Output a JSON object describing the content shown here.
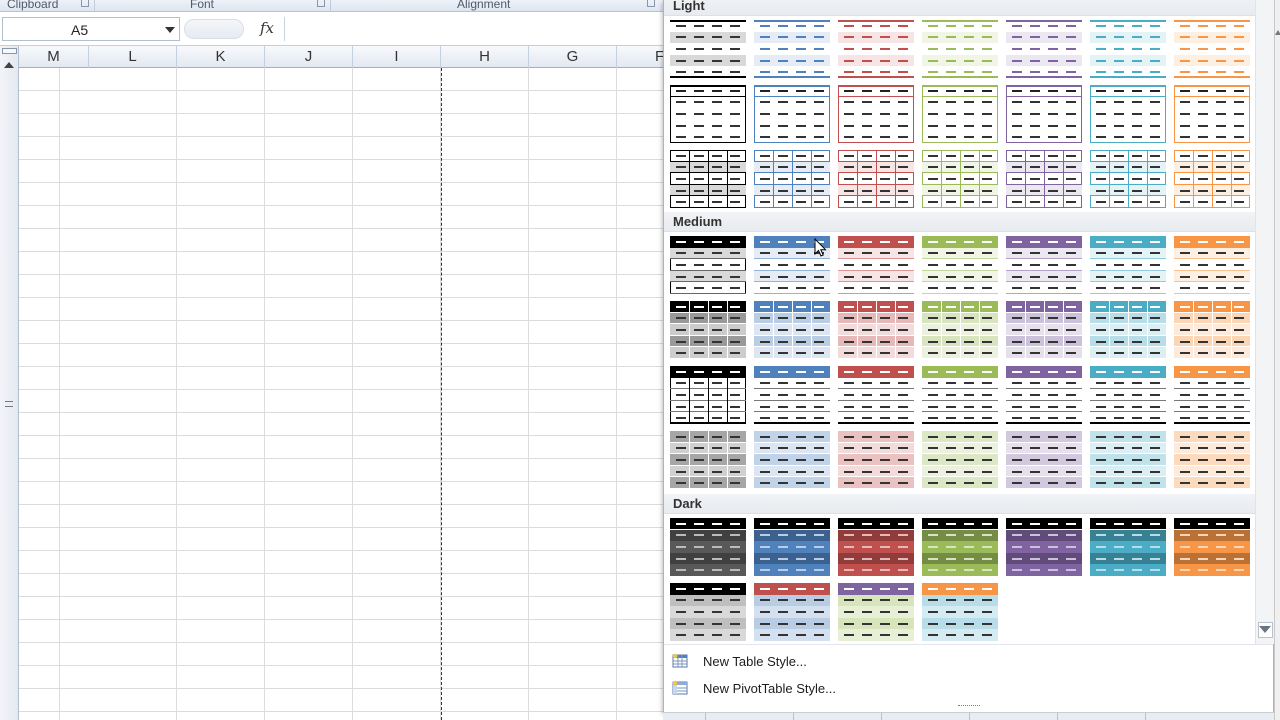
{
  "ribbon_groups": [
    {
      "label": "Clipboard",
      "has_launcher": true
    },
    {
      "label": "Font",
      "has_launcher": true
    },
    {
      "label": "Alignment",
      "has_launcher": true
    }
  ],
  "formula_bar": {
    "name_box_value": "A5",
    "fx_icon": "fx",
    "formula_value": ""
  },
  "sheet": {
    "columns": [
      "M",
      "L",
      "K",
      "J",
      "I",
      "H",
      "G",
      "F"
    ],
    "rtl": true
  },
  "gallery": {
    "sections": [
      {
        "label": "Light",
        "rows": 3
      },
      {
        "label": "Medium",
        "rows": 4
      },
      {
        "label": "Dark",
        "rows": 2
      }
    ],
    "theme_colors": [
      "#000000",
      "#4f81bd",
      "#c0504d",
      "#9bbb59",
      "#8064a2",
      "#4bacc6",
      "#f79646"
    ],
    "light_tints": [
      "#d9d9d9",
      "#dbe5f1",
      "#f2dcdb",
      "#ebf1de",
      "#e4dfec",
      "#daeef3",
      "#fde9d9"
    ],
    "dark_row2_pairs": [
      [
        "#000000",
        "#bfbfbf"
      ],
      [
        "#c0504d",
        "#b8cce4"
      ],
      [
        "#8064a2",
        "#d7e4bc"
      ],
      [
        "#f79646",
        "#b7dee8"
      ]
    ],
    "menu": [
      {
        "label": "New Table Style...",
        "icon": "table-style-icon"
      },
      {
        "label": "New PivotTable Style...",
        "icon": "pivot-style-icon"
      }
    ]
  }
}
